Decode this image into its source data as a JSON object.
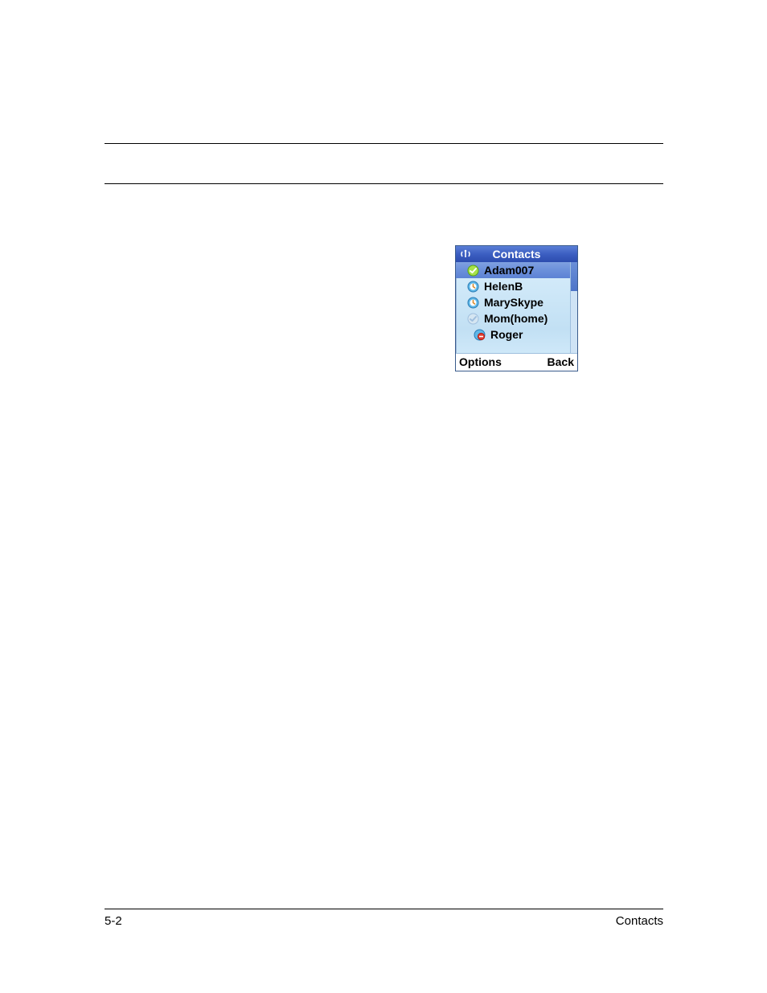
{
  "footer": {
    "page_number": "5-2",
    "section": "Contacts"
  },
  "device": {
    "title": "Contacts",
    "contacts": [
      {
        "name": "Adam007",
        "status": "online",
        "selected": true,
        "indent": false
      },
      {
        "name": "HelenB",
        "status": "away",
        "selected": false,
        "indent": false
      },
      {
        "name": "MarySkype",
        "status": "away",
        "selected": false,
        "indent": false
      },
      {
        "name": "Mom(home)",
        "status": "offline",
        "selected": false,
        "indent": false
      },
      {
        "name": "Roger",
        "status": "dnd",
        "selected": false,
        "indent": true
      }
    ],
    "softkeys": {
      "left": "Options",
      "right": "Back"
    }
  }
}
